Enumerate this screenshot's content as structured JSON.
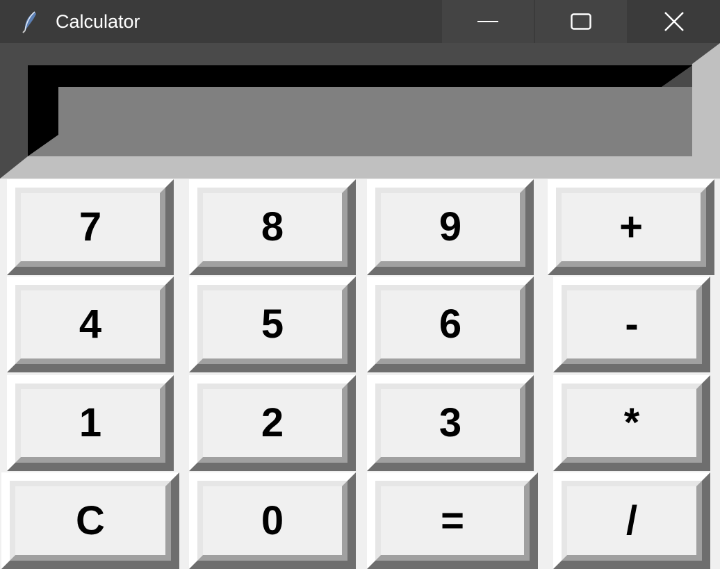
{
  "window": {
    "title": "Calculator"
  },
  "title_controls": {
    "minimize": "minimize",
    "maximize": "maximize",
    "close": "close"
  },
  "display": {
    "value": ""
  },
  "keypad": {
    "rows": [
      [
        "7",
        "8",
        "9",
        "+"
      ],
      [
        "4",
        "5",
        "6",
        "-"
      ],
      [
        "1",
        "2",
        "3",
        "*"
      ],
      [
        "C",
        "0",
        "=",
        "/"
      ]
    ]
  },
  "colors": {
    "titlebar": "#3b3b3b",
    "display_face": "#808080",
    "display_shadow": "#000000",
    "button_face": "#f0f0f0"
  }
}
